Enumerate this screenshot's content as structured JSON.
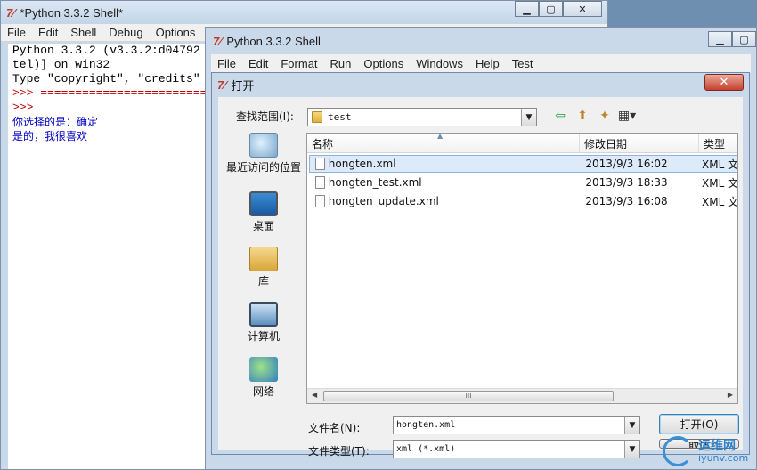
{
  "back_window": {
    "title": "*Python 3.3.2 Shell*",
    "menu": [
      "File",
      "Edit",
      "Shell",
      "Debug",
      "Options"
    ],
    "shell_lines": [
      {
        "text": "Python 3.3.2 (v3.3.2:d04792",
        "color": "black"
      },
      {
        "text": "tel)] on win32",
        "color": "black"
      },
      {
        "text": "Type \"copyright\", \"credits\"",
        "color": "black"
      },
      {
        "text": ">>> ==========================",
        "color": "red"
      },
      {
        "text": ">>>",
        "color": "red"
      },
      {
        "text": "你选择的是：确定",
        "color": "blue"
      },
      {
        "text": "是的，我很喜欢",
        "color": "blue"
      }
    ]
  },
  "middle_window": {
    "title": "Python 3.3.2 Shell",
    "menu": [
      "File",
      "Edit",
      "Format",
      "Run",
      "Options",
      "Windows",
      "Help",
      "Test"
    ]
  },
  "dialog": {
    "title": "打开",
    "look_in_label": "查找范围(I):",
    "look_in_value": "test",
    "places": [
      {
        "label": "最近访问的位置",
        "icon": "recent-places-icon"
      },
      {
        "label": "桌面",
        "icon": "desktop-icon"
      },
      {
        "label": "库",
        "icon": "libraries-icon"
      },
      {
        "label": "计算机",
        "icon": "computer-icon"
      },
      {
        "label": "网络",
        "icon": "network-icon"
      }
    ],
    "columns": [
      "名称",
      "修改日期",
      "类型"
    ],
    "files": [
      {
        "name": "hongten.xml",
        "date": "2013/9/3 16:02",
        "type": "XML 文",
        "selected": true
      },
      {
        "name": "hongten_test.xml",
        "date": "2013/9/3 18:33",
        "type": "XML 文",
        "selected": false
      },
      {
        "name": "hongten_update.xml",
        "date": "2013/9/3 16:08",
        "type": "XML 文",
        "selected": false
      }
    ],
    "scroll_thumb_glyph": "III",
    "filename_label": "文件名(N):",
    "filename_value": "hongten.xml",
    "filetype_label": "文件类型(T):",
    "filetype_value": "xml (*.xml)",
    "open_button": "打开(O)",
    "cancel_button": "取消"
  },
  "watermark": {
    "line1": "运维网",
    "line2": "iyunv.com"
  },
  "colors": {
    "selection": "#dceaf9",
    "shell_prompt": "#c00000",
    "shell_output": "#0000c0"
  }
}
